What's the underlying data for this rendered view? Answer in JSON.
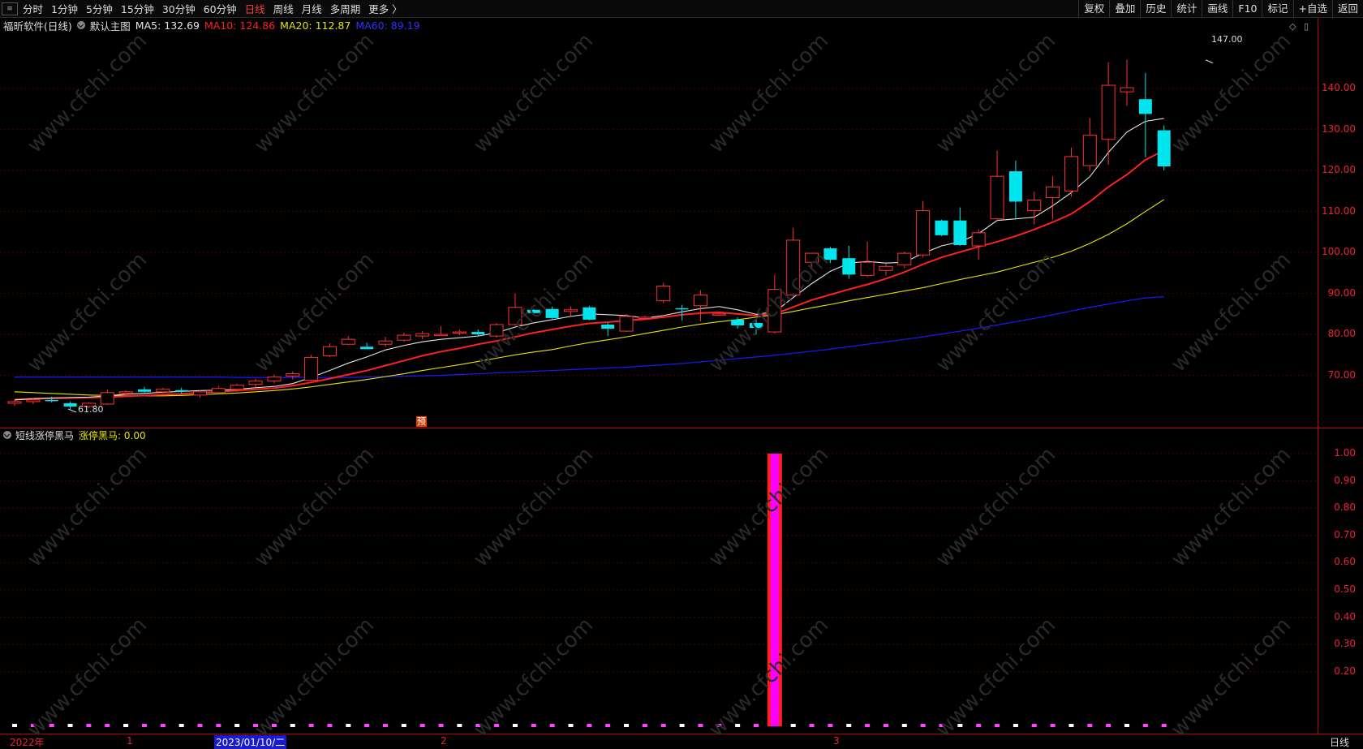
{
  "toolbar": {
    "menu_icon": "menu-icon",
    "left_items": [
      "分时",
      "1分钟",
      "5分钟",
      "15分钟",
      "30分钟",
      "60分钟",
      "日线",
      "周线",
      "月线",
      "多周期",
      "更多 〉"
    ],
    "active_index": 6,
    "right_items": [
      "复权",
      "叠加",
      "历史",
      "统计",
      "画线",
      "F10",
      "标记",
      "+自选",
      "返回"
    ]
  },
  "header": {
    "stock": "福昕软件(日线)",
    "main_chart": "默认主图",
    "ma5": "MA5: 132.69",
    "ma10": "MA10: 124.86",
    "ma20": "MA20: 112.87",
    "ma60": "MA60: 89.19",
    "colors": {
      "ma5": "#e6e6e6",
      "ma10": "#ff2020",
      "ma20": "#e6e600",
      "ma60": "#2020ff"
    }
  },
  "indicator": {
    "name": "短线涨停黑马",
    "value_label": "涨停黑马: 0.00"
  },
  "price_axis": {
    "labels": [
      "140.00",
      "130.00",
      "120.00",
      "110.00",
      "100.00",
      "90.00",
      "80.00",
      "70.00"
    ]
  },
  "indicator_axis": {
    "labels": [
      "1.00",
      "0.90",
      "0.80",
      "0.70",
      "0.60",
      "0.50",
      "0.40",
      "0.30",
      "0.20"
    ]
  },
  "annotations": {
    "high": "147.00",
    "low": "61.80",
    "forecast_mark": "预"
  },
  "date_axis": {
    "labels": [
      "2022年",
      "1",
      "2023/01/10/二",
      "2",
      "3"
    ],
    "period": "日线"
  },
  "watermark": "www.cfchi.com",
  "chart_data": {
    "type": "candlestick",
    "ylim": [
      60,
      150
    ],
    "candles": [
      [
        63.2,
        64.0,
        62.6,
        63.6
      ],
      [
        63.6,
        64.4,
        63.0,
        64.0
      ],
      [
        64.0,
        64.8,
        63.4,
        63.8
      ],
      [
        63.2,
        63.6,
        61.8,
        62.4
      ],
      [
        62.4,
        63.4,
        62.0,
        63.2
      ],
      [
        63.0,
        66.6,
        62.8,
        65.8
      ],
      [
        65.6,
        66.4,
        65.2,
        66.0
      ],
      [
        66.6,
        67.2,
        65.8,
        66.0
      ],
      [
        66.0,
        67.0,
        65.6,
        66.6
      ],
      [
        66.4,
        67.0,
        65.6,
        66.0
      ],
      [
        65.2,
        66.4,
        64.6,
        66.0
      ],
      [
        65.8,
        67.4,
        65.4,
        66.8
      ],
      [
        66.6,
        68.0,
        66.0,
        67.6
      ],
      [
        67.8,
        69.2,
        67.2,
        68.6
      ],
      [
        68.6,
        70.2,
        68.0,
        69.6
      ],
      [
        69.8,
        71.0,
        69.0,
        70.4
      ],
      [
        68.8,
        75.0,
        68.6,
        74.4
      ],
      [
        74.8,
        77.8,
        74.4,
        77.0
      ],
      [
        77.6,
        79.6,
        77.4,
        78.8
      ],
      [
        77.0,
        78.0,
        76.4,
        76.4
      ],
      [
        77.6,
        79.4,
        77.0,
        78.4
      ],
      [
        78.6,
        80.4,
        78.2,
        79.8
      ],
      [
        79.6,
        80.8,
        78.8,
        80.2
      ],
      [
        79.8,
        82.0,
        79.6,
        80.0
      ],
      [
        80.4,
        81.2,
        79.8,
        80.6
      ],
      [
        80.6,
        81.2,
        79.6,
        80.0
      ],
      [
        79.6,
        82.8,
        79.2,
        82.4
      ],
      [
        82.4,
        90.0,
        82.2,
        86.6
      ],
      [
        86.0,
        86.2,
        85.2,
        85.2
      ],
      [
        86.2,
        86.8,
        83.8,
        84.0
      ],
      [
        85.6,
        86.8,
        84.6,
        86.0
      ],
      [
        86.6,
        87.0,
        83.4,
        83.6
      ],
      [
        82.4,
        82.8,
        79.6,
        81.4
      ],
      [
        80.8,
        85.0,
        80.6,
        84.4
      ],
      [
        84.2,
        84.6,
        83.6,
        84.2
      ],
      [
        88.2,
        92.6,
        87.6,
        91.8
      ],
      [
        86.4,
        87.2,
        83.4,
        86.2
      ],
      [
        87.0,
        90.8,
        83.2,
        89.6
      ],
      [
        84.8,
        85.2,
        84.6,
        85.0
      ],
      [
        83.6,
        84.2,
        81.4,
        82.2
      ],
      [
        82.8,
        83.6,
        80.0,
        81.6
      ],
      [
        80.6,
        94.6,
        80.2,
        91.0
      ],
      [
        89.6,
        106.0,
        89.2,
        103.0
      ],
      [
        97.6,
        99.6,
        96.0,
        99.8
      ],
      [
        101.0,
        101.4,
        97.4,
        98.2
      ],
      [
        98.6,
        101.6,
        93.6,
        94.6
      ],
      [
        94.4,
        102.6,
        94.0,
        97.6
      ],
      [
        95.6,
        97.2,
        94.4,
        96.6
      ],
      [
        97.0,
        100.2,
        96.2,
        99.8
      ],
      [
        99.4,
        112.6,
        98.8,
        110.2
      ],
      [
        107.8,
        108.0,
        104.0,
        104.2
      ],
      [
        107.8,
        111.0,
        101.6,
        101.8
      ],
      [
        101.6,
        105.6,
        98.2,
        104.8
      ],
      [
        108.2,
        124.8,
        107.8,
        118.6
      ],
      [
        119.8,
        122.4,
        108.4,
        112.4
      ],
      [
        110.2,
        114.8,
        106.8,
        112.8
      ],
      [
        113.4,
        118.6,
        108.0,
        116.0
      ],
      [
        115.0,
        125.6,
        113.6,
        123.4
      ],
      [
        121.2,
        132.8,
        119.8,
        128.6
      ],
      [
        127.6,
        146.4,
        121.4,
        140.8
      ],
      [
        139.2,
        147.0,
        135.8,
        140.2
      ],
      [
        137.4,
        143.8,
        123.2,
        133.8
      ],
      [
        129.8,
        131.0,
        120.0,
        121.0
      ]
    ],
    "ma5": [
      64.0,
      64.3,
      64.5,
      64.6,
      64.7,
      65.0,
      65.4,
      65.6,
      65.9,
      66.1,
      66.3,
      66.4,
      66.6,
      67.0,
      67.3,
      68.0,
      69.5,
      71.2,
      73.0,
      74.5,
      76.2,
      77.3,
      78.2,
      78.8,
      79.2,
      79.6,
      80.4,
      81.8,
      82.8,
      83.6,
      84.4,
      85.0,
      84.8,
      84.6,
      84.0,
      84.6,
      85.5,
      86.3,
      86.8,
      86.0,
      84.9,
      85.5,
      89.0,
      92.4,
      95.4,
      97.4,
      97.8,
      97.4,
      97.6,
      99.8,
      101.6,
      102.6,
      104.6,
      107.8,
      108.2,
      108.6,
      111.4,
      114.6,
      118.5,
      124.4,
      129.4,
      132.0,
      132.7
    ],
    "ma10": [
      64.1,
      64.3,
      64.4,
      64.5,
      64.6,
      64.7,
      64.9,
      65.1,
      65.3,
      65.5,
      65.8,
      66.0,
      66.3,
      66.6,
      66.9,
      67.5,
      68.3,
      69.2,
      70.2,
      71.2,
      72.4,
      73.6,
      74.8,
      75.8,
      76.6,
      77.6,
      78.4,
      79.4,
      80.4,
      81.2,
      82.0,
      82.7,
      83.0,
      83.4,
      83.7,
      84.2,
      84.8,
      85.2,
      85.4,
      85.0,
      84.6,
      85.0,
      86.7,
      88.4,
      89.7,
      91.0,
      92.2,
      93.6,
      95.2,
      97.1,
      98.8,
      100.1,
      101.4,
      102.6,
      104.0,
      105.6,
      107.4,
      109.4,
      112.4,
      116.0,
      119.0,
      122.6,
      124.9
    ],
    "ma20": [
      66.0,
      65.8,
      65.6,
      65.4,
      65.2,
      65.1,
      65.0,
      65.0,
      65.0,
      65.1,
      65.3,
      65.5,
      65.7,
      66.0,
      66.3,
      66.7,
      67.2,
      67.8,
      68.4,
      69.0,
      69.7,
      70.4,
      71.2,
      71.9,
      72.6,
      73.4,
      74.2,
      75.0,
      75.7,
      76.3,
      77.2,
      78.0,
      78.7,
      79.4,
      80.2,
      81.0,
      81.8,
      82.5,
      83.1,
      83.6,
      84.2,
      84.8,
      85.6,
      86.5,
      87.3,
      88.2,
      89.0,
      89.8,
      90.6,
      91.4,
      92.4,
      93.4,
      94.3,
      95.2,
      96.4,
      97.6,
      98.8,
      100.3,
      102.2,
      104.4,
      107.0,
      110.0,
      112.9
    ],
    "ma60": [
      69.6,
      69.6,
      69.6,
      69.6,
      69.6,
      69.6,
      69.6,
      69.6,
      69.6,
      69.6,
      69.6,
      69.6,
      69.5,
      69.5,
      69.5,
      69.5,
      69.5,
      69.5,
      69.5,
      69.6,
      69.7,
      69.8,
      69.9,
      70.0,
      70.2,
      70.4,
      70.6,
      70.8,
      71.0,
      71.2,
      71.4,
      71.6,
      71.8,
      72.0,
      72.3,
      72.6,
      72.9,
      73.3,
      73.7,
      74.1,
      74.5,
      74.9,
      75.4,
      75.9,
      76.4,
      77.0,
      77.6,
      78.2,
      78.8,
      79.4,
      80.1,
      80.8,
      81.5,
      82.3,
      83.1,
      83.9,
      84.8,
      85.7,
      86.6,
      87.4,
      88.2,
      88.9,
      89.2
    ],
    "indicator": {
      "ylim": [
        0,
        1.05
      ],
      "spike_index": 41,
      "spike_value": 1.0
    }
  }
}
